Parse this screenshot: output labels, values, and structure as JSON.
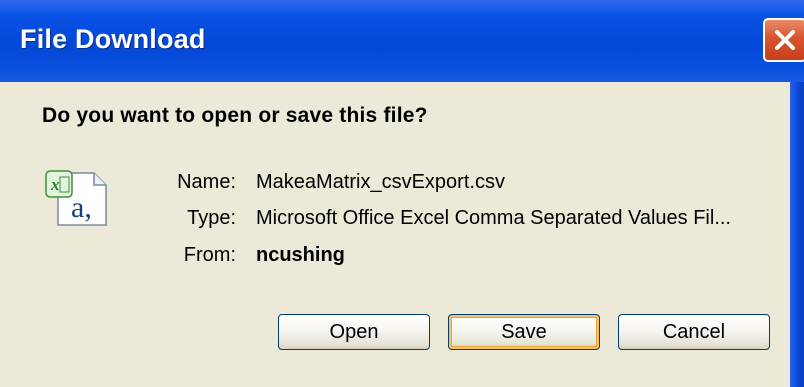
{
  "window": {
    "title": "File Download",
    "close_icon": "close-x-icon"
  },
  "dialog": {
    "question": "Do you want to open or save this file?",
    "file_icon": "excel-csv-file-icon",
    "name_label": "Name:",
    "name_value": "MakeaMatrix_csvExport.csv",
    "type_label": "Type:",
    "type_value": "Microsoft Office Excel Comma Separated Values Fil...",
    "from_label": "From:",
    "from_value": "ncushing"
  },
  "buttons": {
    "open_label": "Open",
    "save_label": "Save",
    "cancel_label": "Cancel"
  },
  "colors": {
    "titlebar": "#0348d8",
    "client_bg": "#ece9d8",
    "close_button": "#d9532e",
    "default_button_highlight": "#f7c26a"
  }
}
